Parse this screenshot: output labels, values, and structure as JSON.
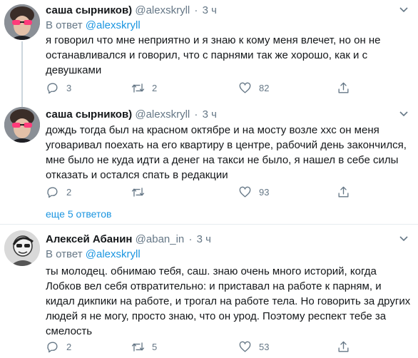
{
  "tweets": [
    {
      "author_name": "саша сырников)",
      "author_handle": "@alexskryll",
      "dot": "·",
      "time": "3 ч",
      "reply_label": "В ответ",
      "reply_mention": "@alexskryll",
      "lines": [
        "я говорил что мне неприятно и я знаю к кому меня влечет, но он не",
        "останавливался и говорил, что с парнями так же хорошо, как и с",
        "девушками"
      ],
      "reply_count": "3",
      "retweet_count": "2",
      "like_count": "82"
    },
    {
      "author_name": "саша сырников)",
      "author_handle": "@alexskryll",
      "dot": "·",
      "time": "3 ч",
      "lines": [
        "дождь тогда был на красном октябре и на мосту возле ххс он меня",
        "уговаривал поехать на его квартиру в центре, рабочий день закончился,",
        "мне было не куда идти а денег на такси не было, я нашел в себе силы",
        "отказать и остался спать в редакции"
      ],
      "reply_count": "2",
      "retweet_count": "",
      "like_count": "93"
    },
    {
      "author_name": "Алексей Абанин",
      "author_handle": "@aban_in",
      "dot": "·",
      "time": "3 ч",
      "reply_label": "В ответ",
      "reply_mention": "@alexskryll",
      "lines": [
        "ты молодец. обнимаю тебя, саш. знаю очень много историй, когда",
        "Лобков вел себя отвратительно: и приставал на работе к парням, и",
        "кидал дикпики на работе, и трогал на работе тела. Но говорить за других",
        "людей я не могу, просто знаю, что он урод. Поэтому респект тебе за",
        "смелость"
      ],
      "reply_count": "2",
      "retweet_count": "5",
      "like_count": "53"
    }
  ],
  "show_more_replies": "еще 5 ответов",
  "icons": {
    "more": "more-icon",
    "reply": "reply-icon",
    "retweet": "retweet-icon",
    "like": "like-icon",
    "share": "share-icon"
  },
  "colors": {
    "link": "#1b95e0",
    "secondary_text": "#657786",
    "thread_line": "#ccd6dd",
    "avatar_glasses": "#ff3b7a"
  }
}
